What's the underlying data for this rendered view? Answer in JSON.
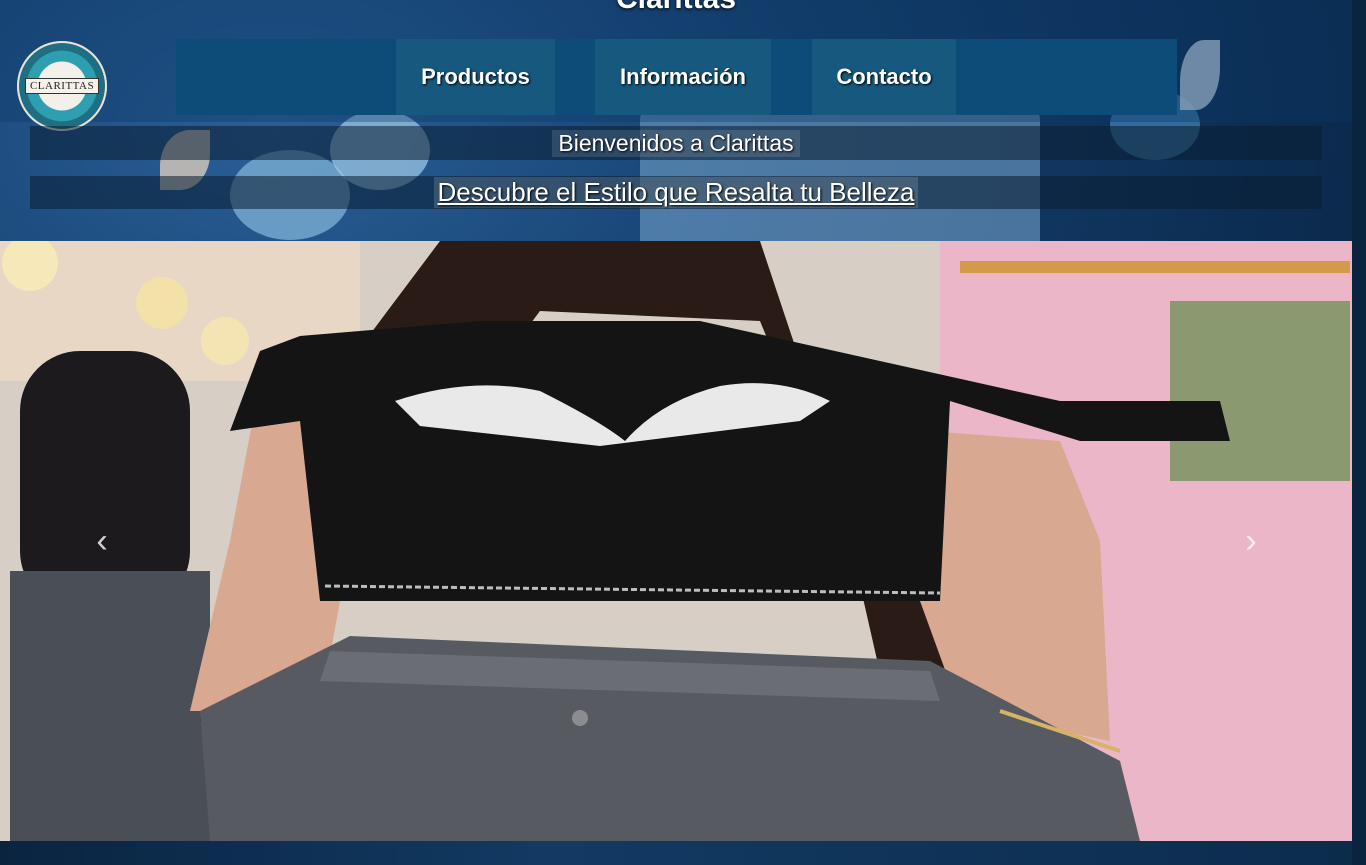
{
  "site": {
    "title": "Clarittas",
    "logo_text": "CLARITTAS"
  },
  "nav": {
    "items": [
      {
        "label": "Productos"
      },
      {
        "label": "Información"
      },
      {
        "label": "Contacto"
      }
    ]
  },
  "hero": {
    "welcome": "Bienvenidos a Clarittas",
    "tagline": "Descubre el Estilo que Resalta tu Belleza"
  },
  "carousel": {
    "prev_icon": "chevron-left-icon",
    "next_icon": "chevron-right-icon",
    "prev_glyph": "‹",
    "next_glyph": "›"
  },
  "colors": {
    "nav_bg": "#0d4c78",
    "nav_item_bg": "#17587f",
    "page_bg": "#143f6e"
  }
}
